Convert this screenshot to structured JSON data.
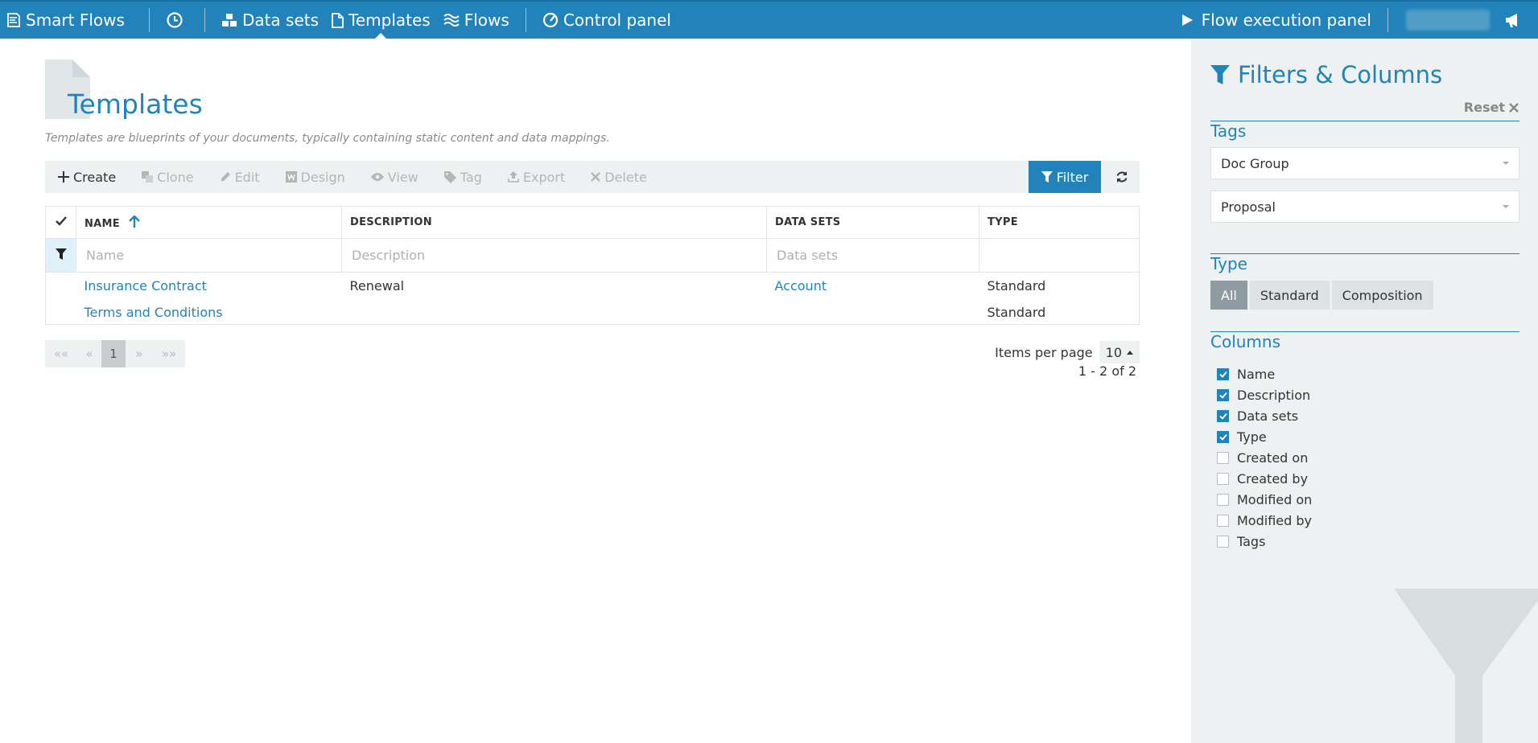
{
  "nav": {
    "brand": "Smart Flows",
    "items": [
      {
        "label": "Data sets"
      },
      {
        "label": "Templates"
      },
      {
        "label": "Flows"
      },
      {
        "label": "Control panel"
      }
    ],
    "execution_panel": "Flow execution panel"
  },
  "page": {
    "title": "Templates",
    "description": "Templates are blueprints of your documents, typically containing static content and data mappings."
  },
  "toolbar": {
    "create": "Create",
    "clone": "Clone",
    "edit": "Edit",
    "design": "Design",
    "view": "View",
    "tag": "Tag",
    "export": "Export",
    "delete": "Delete",
    "filter": "Filter"
  },
  "table": {
    "columns": [
      "NAME",
      "DESCRIPTION",
      "DATA SETS",
      "TYPE"
    ],
    "filter_placeholders": [
      "Name",
      "Description",
      "Data sets"
    ],
    "rows": [
      {
        "name": "Insurance Contract",
        "description": "Renewal",
        "data_sets": "Account",
        "type": "Standard"
      },
      {
        "name": "Terms and Conditions",
        "description": "",
        "data_sets": "",
        "type": "Standard"
      }
    ]
  },
  "pagination": {
    "first": "««",
    "prev": "«",
    "current": "1",
    "next": "»",
    "last": "»»",
    "items_per_page_label": "Items per page",
    "items_per_page": "10",
    "range": "1 - 2 of 2"
  },
  "panel": {
    "title": "Filters & Columns",
    "reset": "Reset",
    "tags_heading": "Tags",
    "tag_selects": [
      "Doc Group",
      "Proposal"
    ],
    "type_heading": "Type",
    "type_options": [
      "All",
      "Standard",
      "Composition"
    ],
    "type_selected": "All",
    "columns_heading": "Columns",
    "columns": [
      {
        "label": "Name",
        "checked": true
      },
      {
        "label": "Description",
        "checked": true
      },
      {
        "label": "Data sets",
        "checked": true
      },
      {
        "label": "Type",
        "checked": true
      },
      {
        "label": "Created on",
        "checked": false
      },
      {
        "label": "Created by",
        "checked": false
      },
      {
        "label": "Modified on",
        "checked": false
      },
      {
        "label": "Modified by",
        "checked": false
      },
      {
        "label": "Tags",
        "checked": false
      }
    ]
  },
  "colors": {
    "accent": "#2183b9",
    "panel_bg": "#edf1f2"
  }
}
